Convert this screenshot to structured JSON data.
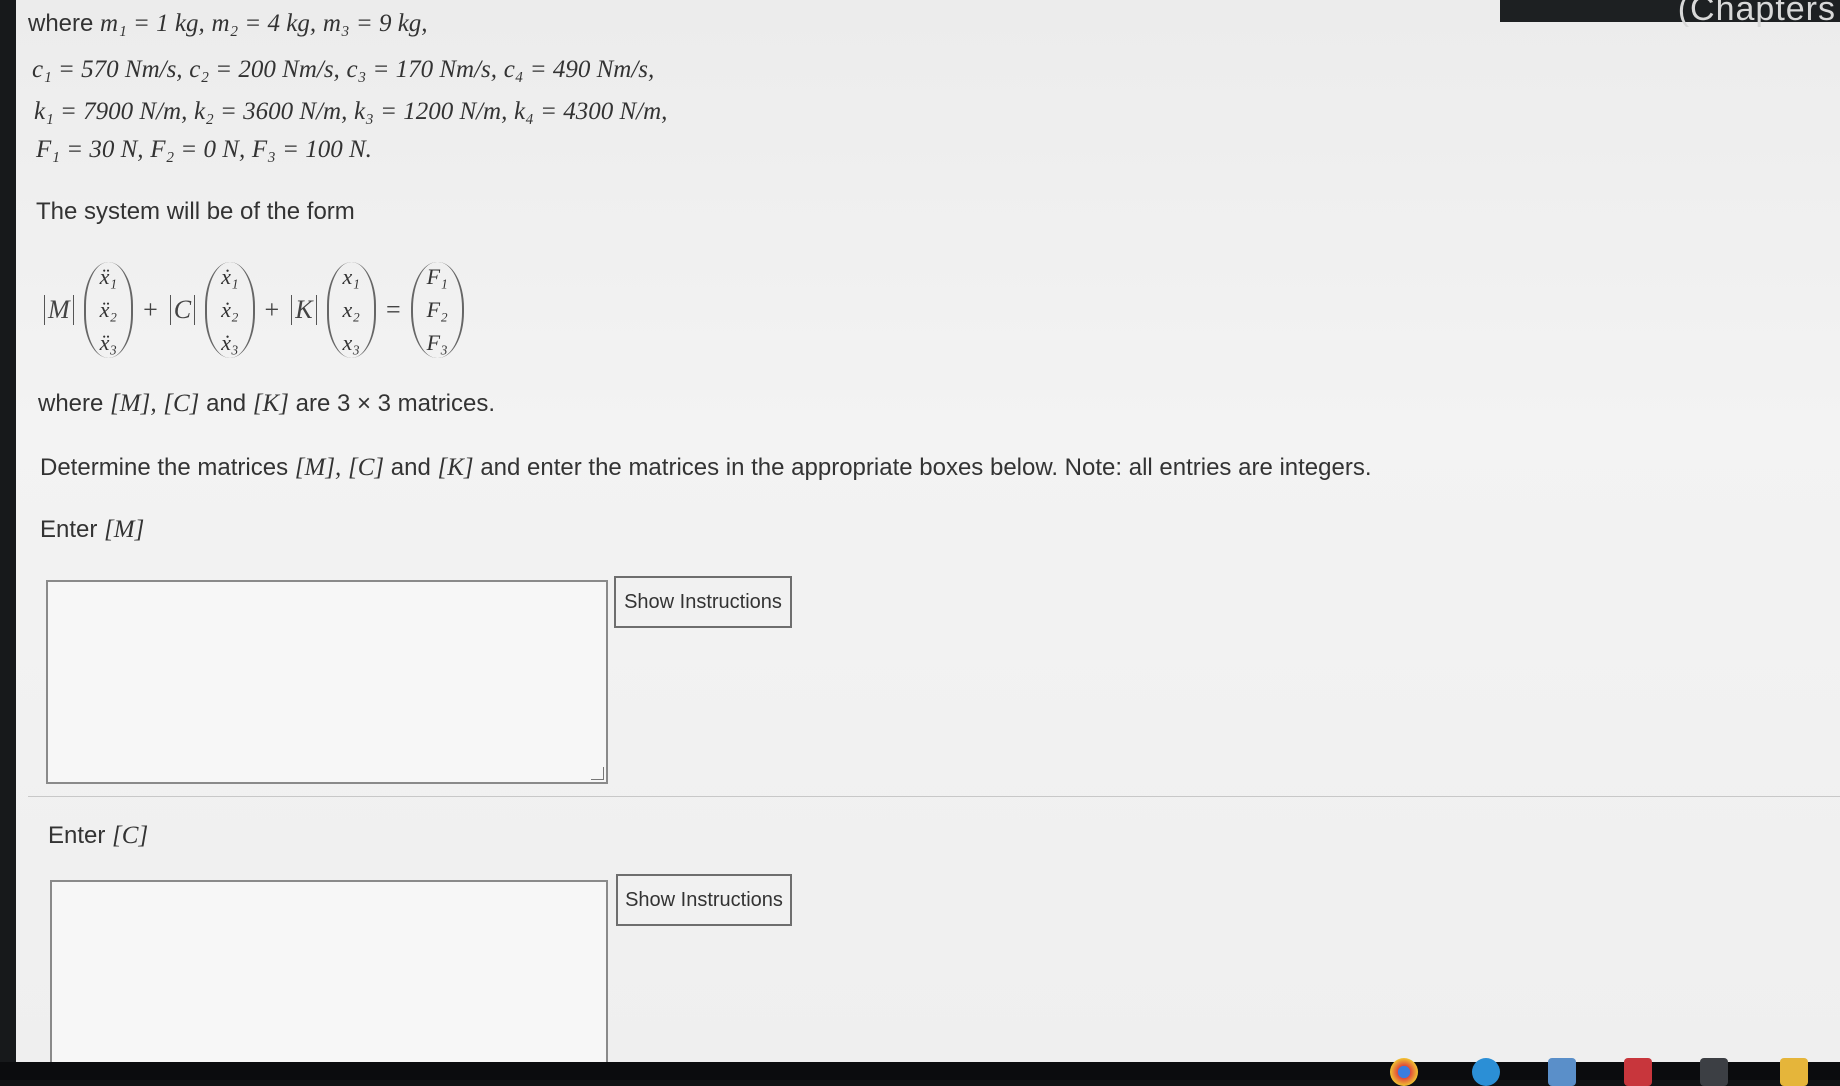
{
  "window": {
    "title_fragment": "(Chapters"
  },
  "given": {
    "line1": {
      "prefix": "where",
      "parts": [
        "m₁ = 1 kg,",
        "m₂ = 4 kg,",
        "m₃ = 9 kg,"
      ]
    },
    "line2": [
      "c₁ = 570 Nm/s,",
      "c₂ = 200 Nm/s,",
      "c₃ = 170 Nm/s,",
      "c₄ = 490 Nm/s,"
    ],
    "line3": [
      "k₁ = 7900 N/m,",
      "k₂ = 3600 N/m,",
      "k₃ = 1200 N/m,",
      "k₄ = 4300 N/m,"
    ],
    "line4": [
      "F₁ = 30 N,",
      "F₂ = 0 N,",
      "F₃ = 100 N."
    ]
  },
  "system_form_text": "The system will be of the form",
  "equation": {
    "M": "M",
    "C": "C",
    "K": "K",
    "plus": "+",
    "equals": "=",
    "accel": [
      "ẍ₁",
      "ẍ₂",
      "ẍ₃"
    ],
    "vel": [
      "ẋ₁",
      "ẋ₂",
      "ẋ₃"
    ],
    "disp": [
      "x₁",
      "x₂",
      "x₃"
    ],
    "force": [
      "F₁",
      "F₂",
      "F₃"
    ]
  },
  "matrices_text": {
    "prefix": "where",
    "M": "[M],",
    "C": "[C]",
    "and": "and",
    "K": "[K]",
    "suffix": "are 3 × 3 matrices."
  },
  "determine_text": {
    "part1": "Determine the matrices",
    "M": "[M],",
    "C": "[C]",
    "and": "and",
    "K": "[K]",
    "part2": "and enter the matrices in the appropriate boxes below. Note: all entries are integers."
  },
  "sections": [
    {
      "label": "Enter",
      "matrix": "[M]",
      "value": "",
      "button": "Show Instructions"
    },
    {
      "label": "Enter",
      "matrix": "[C]",
      "value": "",
      "button": "Show Instructions"
    }
  ],
  "colors": {
    "page_bg": "#efefef",
    "text": "#333333",
    "bezel": "#101214"
  },
  "taskbar": {
    "icons": [
      "chrome-icon",
      "edge-icon",
      "generic-app-icon",
      "mail-icon",
      "calculator-icon",
      "folder-icon"
    ]
  }
}
